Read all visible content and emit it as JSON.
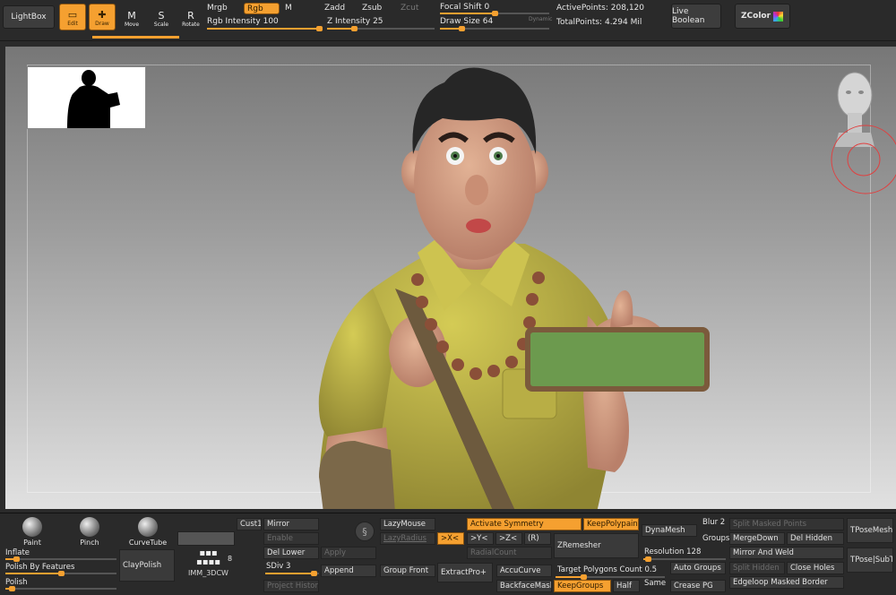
{
  "top_bar": {
    "lightbox": "LightBox",
    "tools": [
      {
        "label": "Edit",
        "icon": "edit-icon",
        "glyph": "▭",
        "active": true
      },
      {
        "label": "Draw",
        "icon": "draw-icon",
        "glyph": "✚",
        "active": true
      },
      {
        "label": "Move",
        "icon": "move-icon",
        "glyph": "M",
        "active": false
      },
      {
        "label": "Scale",
        "icon": "scale-icon",
        "glyph": "S",
        "active": false
      },
      {
        "label": "Rotate",
        "icon": "rotate-icon",
        "glyph": "R",
        "active": false
      }
    ],
    "mrgb": "Mrgb",
    "rgb": "Rgb",
    "m": "M",
    "rgb_intensity_label": "Rgb Intensity",
    "rgb_intensity": "100",
    "rgb_intensity_level": 1.0,
    "zadd": "Zadd",
    "zsub": "Zsub",
    "zcut": "Zcut",
    "z_intensity_label": "Z Intensity",
    "z_intensity": "25",
    "z_intensity_level": 0.25,
    "focal_shift_label": "Focal Shift",
    "focal_shift": "0",
    "focal_shift_level": 0.5,
    "draw_size_label": "Draw Size",
    "draw_size": "64",
    "draw_size_level": 0.2,
    "dynamic": "Dynamic",
    "active_points_label": "ActivePoints:",
    "active_points": "208,120",
    "total_points_label": "TotalPoints:",
    "total_points": "4.294 Mil",
    "live_boolean": "Live Boolean",
    "zcolor": "ZColor"
  },
  "colors": {
    "accent": "#f5a030",
    "panel": "#2a2a2a",
    "button": "#3a3a3a",
    "shirt": "#c7bd45",
    "phone_screen": "#6c9a4e",
    "hair": "#262626",
    "skin": "#d7a181"
  },
  "bottom_bar": {
    "brushes": [
      {
        "label": "Paint",
        "icon": "paint-brush-icon"
      },
      {
        "label": "Pinch",
        "icon": "pinch-brush-icon"
      },
      {
        "label": "CurveTube",
        "icon": "curvetube-brush-icon"
      }
    ],
    "inflate_label": "Inflate",
    "inflate_level": 0.1,
    "polish_by_features_label": "Polish By Features",
    "polish_by_features_level": 0.5,
    "polish_label": "Polish",
    "polish_level": 0.06,
    "claypolish": "ClayPolish",
    "imm_label": "IMM_3DCW",
    "imm_count": "8",
    "cust1": "Cust1",
    "mirror": "Mirror",
    "enable": "Enable",
    "del_lower": "Del Lower",
    "apply": "Apply",
    "sdiv_label": "SDiv",
    "sdiv": "3",
    "sdiv_level": 0.9,
    "append": "Append",
    "project_history": "Project History",
    "lazymouse": "LazyMouse",
    "lazyradius": "LazyRadius",
    "group_front": "Group Front",
    "activate_symmetry": "Activate Symmetry",
    "sym_x": ">X<",
    "sym_y": ">Y<",
    "sym_z": ">Z<",
    "sym_r": "(R)",
    "radialcount": "RadialCount",
    "extractpro": "ExtractPro+",
    "accucurve": "AccuCurve",
    "backfacemask": "BackfaceMask",
    "keeppolypaint": "KeepPolypaint",
    "zremesher": "ZRemesher",
    "target_polygons_label": "Target Polygons Count",
    "target_polygons": "0.5",
    "target_polygons_level": 0.25,
    "keepgroups": "KeepGroups",
    "half": "Half",
    "dynamesh": "DynaMesh",
    "blur_label": "Blur",
    "blur": "2",
    "groups": "Groups",
    "resolution_label": "Resolution",
    "resolution": "128",
    "resolution_level": 0.05,
    "auto_groups": "Auto Groups",
    "same": "Same",
    "crease_pg": "Crease PG",
    "split_masked_points": "Split Masked Points",
    "mergedown": "MergeDown",
    "del_hidden": "Del Hidden",
    "mirror_and_weld": "Mirror And Weld",
    "split_hidden": "Split Hidden",
    "close_holes": "Close Holes",
    "edgeloop_masked_border": "Edgeloop Masked Border",
    "tposemesh": "TPoseMesh",
    "tpose_subt": "TPose|SubT"
  }
}
